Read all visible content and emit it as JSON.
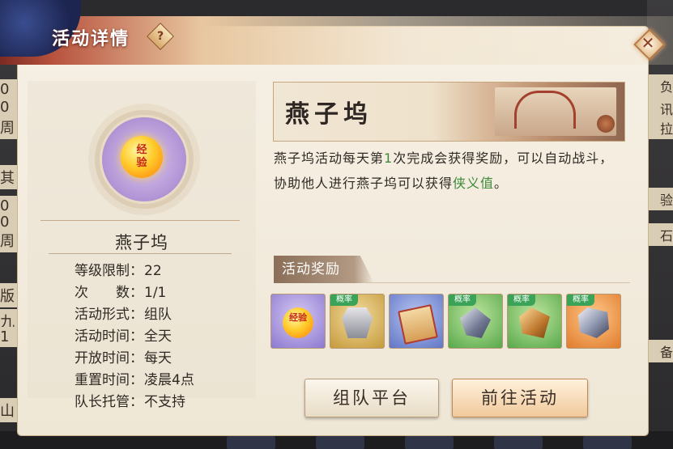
{
  "background": {
    "left_peek": [
      "0",
      "0",
      "周",
      "其",
      "0",
      "0",
      "周",
      "版",
      "九",
      "1",
      "山"
    ],
    "right_peek": [
      "负",
      "讯拉",
      "验",
      "石",
      "备"
    ]
  },
  "dialog": {
    "title": "活动详情",
    "help_icon": "?",
    "close_icon": "✕"
  },
  "left_card": {
    "medal_text_1": "经",
    "medal_text_2": "验",
    "activity_name": "燕子坞",
    "info": [
      {
        "label": "等级限制：",
        "value": "22"
      },
      {
        "label": "次　　数：",
        "value": "1/1"
      },
      {
        "label": "活动形式：",
        "value": "组队"
      },
      {
        "label": "活动时间：",
        "value": "全天"
      },
      {
        "label": "开放时间：",
        "value": "每天"
      },
      {
        "label": "重置时间：",
        "value": "凌晨4点"
      },
      {
        "label": "队长托管：",
        "value": "不支持"
      }
    ]
  },
  "banner": {
    "title": "燕子坞"
  },
  "description": {
    "part1": "燕子坞活动每天第",
    "count": "1",
    "part2": "次完成会获得奖励，可以自动战斗，协助他人进行燕子坞可以获得",
    "highlight": "侠义值",
    "part3": "。"
  },
  "rewards": {
    "tag": "活动奖励",
    "items": [
      {
        "name": "exp-medal",
        "quality": "purple",
        "prob": "",
        "text": "经验"
      },
      {
        "name": "armor",
        "quality": "gold",
        "prob": "概率",
        "text": ""
      },
      {
        "name": "scroll",
        "quality": "blue",
        "prob": "",
        "text": ""
      },
      {
        "name": "crystal-ore",
        "quality": "green",
        "prob": "概率",
        "text": ""
      },
      {
        "name": "bronze-ore",
        "quality": "green",
        "prob": "概率",
        "text": ""
      },
      {
        "name": "steel-ore",
        "quality": "orange",
        "prob": "概率",
        "text": ""
      }
    ]
  },
  "buttons": {
    "team": "组队平台",
    "go": "前往活动"
  },
  "colors": {
    "highlight_green": "#3e8a3a",
    "prob_green": "#3aa357"
  }
}
